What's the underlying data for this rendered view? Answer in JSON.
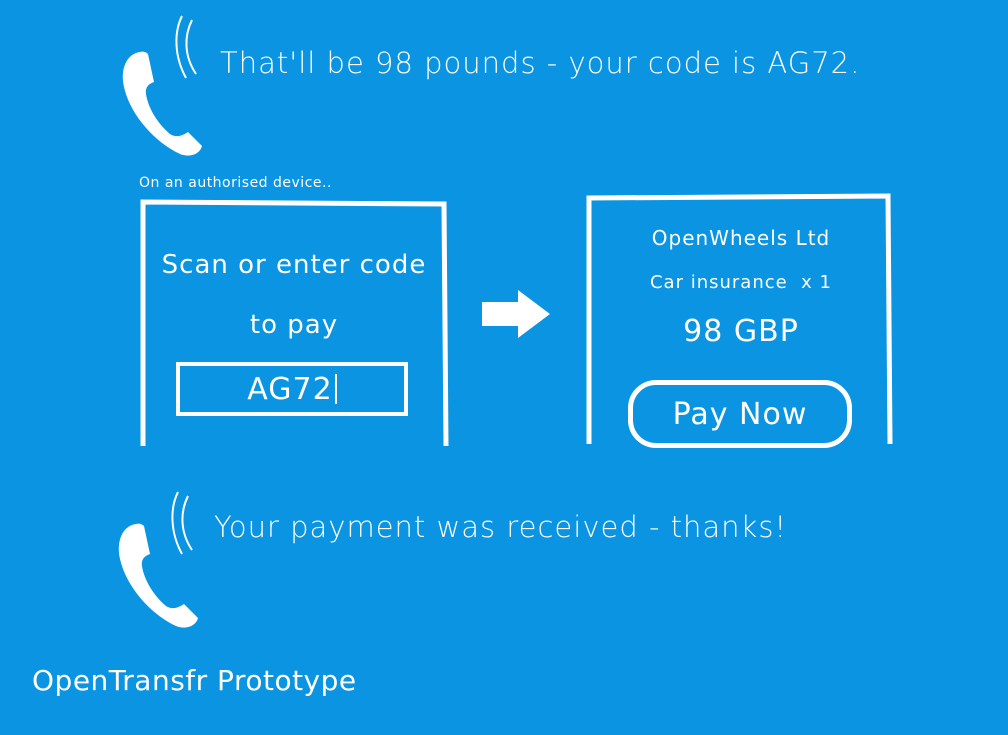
{
  "call_top": {
    "message": "That'll be 98 pounds - your code is AG72."
  },
  "device_note": "On an authorised device..",
  "scan_screen": {
    "line1": "Scan or enter code",
    "line2": "to pay",
    "code_value": "AG72"
  },
  "confirm_screen": {
    "merchant": "OpenWheels Ltd",
    "item": "Car insurance",
    "quantity": "x 1",
    "amount": "98 GBP",
    "pay_button": "Pay Now"
  },
  "call_bottom": {
    "message": "Your payment was received - thanks!"
  },
  "footer_title": "OpenTransfr Prototype",
  "colors": {
    "background": "#0a94e2",
    "foreground": "#ffffff"
  },
  "icons": [
    "phone-handset-icon",
    "sound-waves-icon",
    "arrow-right-icon"
  ]
}
